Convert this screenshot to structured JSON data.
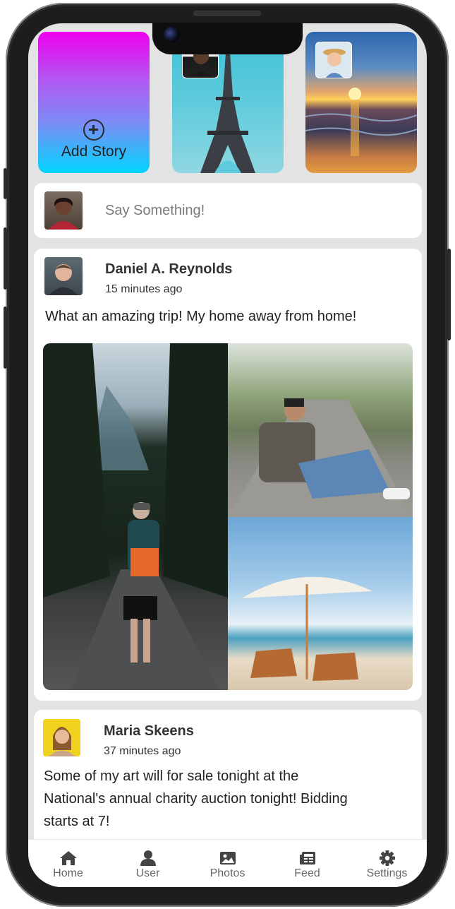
{
  "stories": {
    "add_label": "Add Story"
  },
  "composer": {
    "placeholder": "Say Something!"
  },
  "posts": [
    {
      "author": "Daniel A. Reynolds",
      "time": "15 minutes ago",
      "text": "What an amazing trip! My home away from home!"
    },
    {
      "author": "Maria Skeens",
      "time": "37 minutes ago",
      "text": "Some of my art will for sale tonight at the National's annual charity auction tonight! Bidding starts at 7!"
    }
  ],
  "nav": {
    "items": [
      {
        "label": "Home",
        "icon": "home-icon"
      },
      {
        "label": "User",
        "icon": "user-icon"
      },
      {
        "label": "Photos",
        "icon": "photos-icon"
      },
      {
        "label": "Feed",
        "icon": "feed-icon"
      },
      {
        "label": "Settings",
        "icon": "gear-icon"
      }
    ]
  },
  "colors": {
    "background": "#e3e3e3",
    "card": "#ffffff",
    "text": "#333333",
    "muted": "#7a7a7a",
    "nav_text": "#666666"
  }
}
